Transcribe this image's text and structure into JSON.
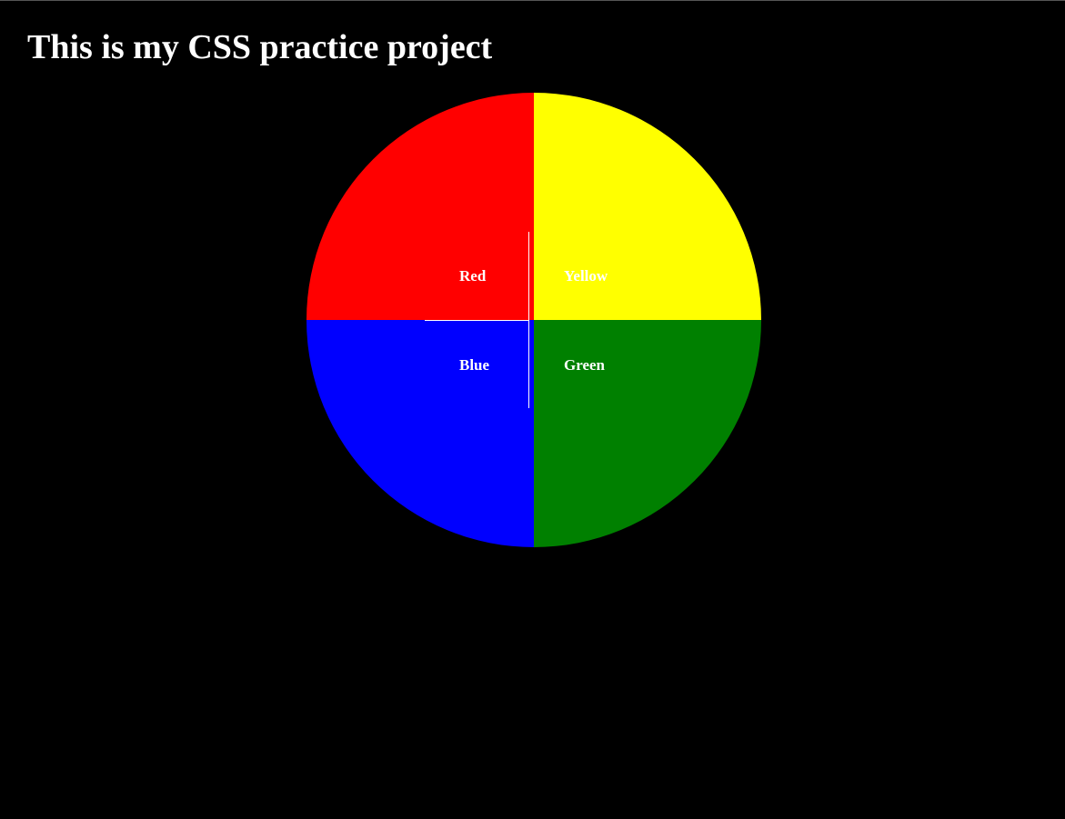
{
  "page": {
    "title": "This is my CSS practice project",
    "background": "#000000"
  },
  "circle": {
    "quadrants": [
      {
        "id": "red",
        "label": "Red",
        "color": "#ff0000"
      },
      {
        "id": "yellow",
        "label": "Yellow",
        "color": "#ffff00"
      },
      {
        "id": "blue",
        "label": "Blue",
        "color": "#0000ff"
      },
      {
        "id": "green",
        "label": "Green",
        "color": "#008000"
      }
    ],
    "label_color": "#ffffff"
  }
}
